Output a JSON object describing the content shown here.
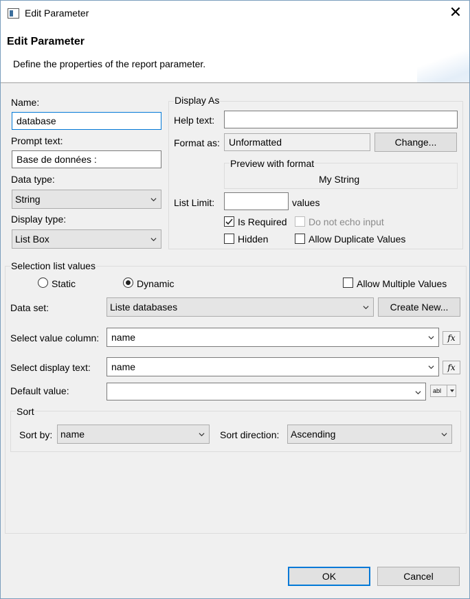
{
  "window": {
    "title": "Edit Parameter",
    "close_icon": "close-icon",
    "app_icon": "dialog-icon"
  },
  "header": {
    "title": "Edit Parameter",
    "description": "Define the properties of the report parameter."
  },
  "left": {
    "name_label": "Name:",
    "name_value": "database",
    "prompt_label": "Prompt text:",
    "prompt_value": "Base de données :",
    "datatype_label": "Data type:",
    "datatype_value": "String",
    "displaytype_label": "Display type:",
    "displaytype_value": "List Box"
  },
  "display_as": {
    "group_title": "Display As",
    "help_label": "Help text:",
    "help_value": "",
    "format_label": "Format as:",
    "format_value": "Unformatted",
    "change_button": "Change...",
    "preview_title": "Preview with format",
    "preview_value": "My String",
    "listlimit_label": "List Limit:",
    "listlimit_value": "",
    "values_label": "values",
    "is_required_label": "Is Required",
    "is_required_checked": true,
    "no_echo_label": "Do not echo input",
    "no_echo_checked": false,
    "hidden_label": "Hidden",
    "hidden_checked": false,
    "allow_dup_label": "Allow Duplicate Values",
    "allow_dup_checked": false
  },
  "selection": {
    "group_title": "Selection list values",
    "static_label": "Static",
    "dynamic_label": "Dynamic",
    "selected": "Dynamic",
    "allow_multiple_label": "Allow Multiple Values",
    "allow_multiple_checked": false,
    "dataset_label": "Data set:",
    "dataset_value": "Liste databases",
    "create_new_button": "Create New...",
    "value_column_label": "Select value column:",
    "value_column_value": "name",
    "display_text_label": "Select display text:",
    "display_text_value": "name",
    "default_label": "Default value:",
    "default_value": "",
    "fx_symbol": "fx",
    "abl_text": "abl"
  },
  "sort": {
    "group_title": "Sort",
    "sortby_label": "Sort by:",
    "sortby_value": "name",
    "direction_label": "Sort direction:",
    "direction_value": "Ascending"
  },
  "footer": {
    "ok": "OK",
    "cancel": "Cancel"
  }
}
